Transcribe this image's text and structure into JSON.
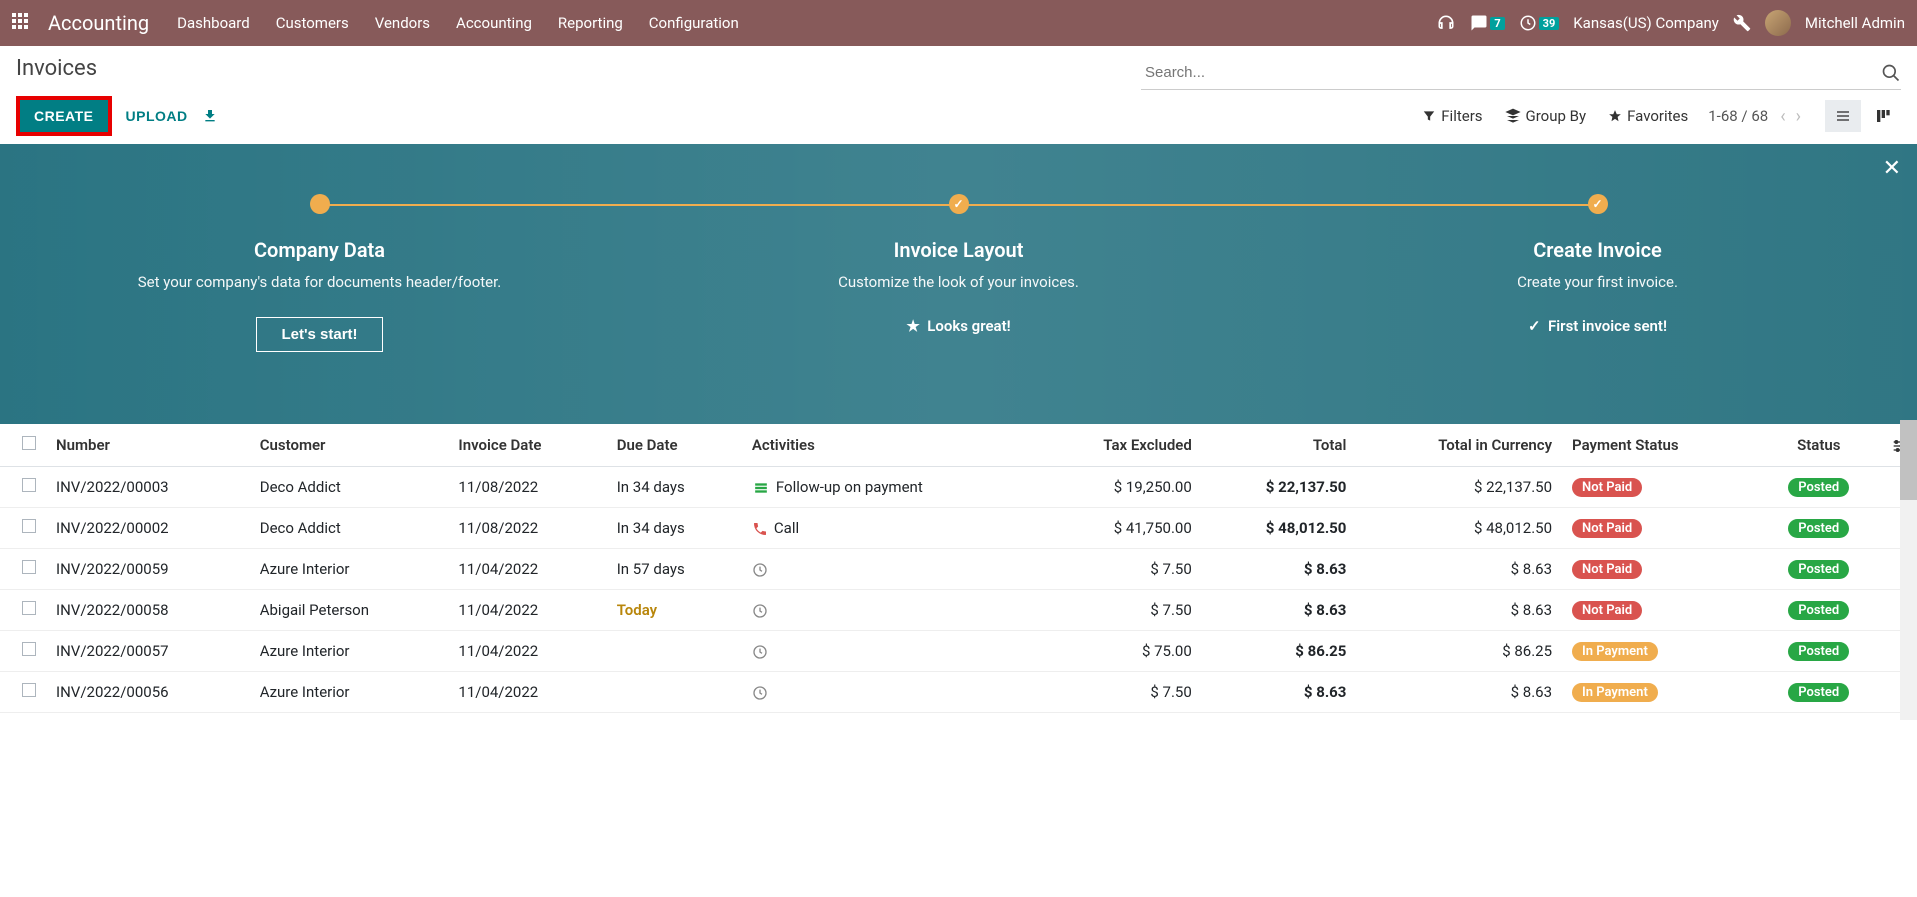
{
  "nav": {
    "brand": "Accounting",
    "menu": [
      "Dashboard",
      "Customers",
      "Vendors",
      "Accounting",
      "Reporting",
      "Configuration"
    ],
    "messages_count": "7",
    "activities_count": "39",
    "company": "Kansas(US) Company",
    "user": "Mitchell Admin"
  },
  "cp": {
    "title": "Invoices",
    "create": "CREATE",
    "upload": "UPLOAD",
    "search_placeholder": "Search...",
    "filters": "Filters",
    "groupby": "Group By",
    "favorites": "Favorites",
    "pager": "1-68 / 68"
  },
  "onboard": {
    "steps": [
      {
        "title": "Company Data",
        "desc": "Set your company's data for documents header/footer.",
        "action": "Let's start!",
        "done": false,
        "action_type": "button"
      },
      {
        "title": "Invoice Layout",
        "desc": "Customize the look of your invoices.",
        "action": "Looks great!",
        "done": true,
        "action_type": "text",
        "action_icon": "star"
      },
      {
        "title": "Create Invoice",
        "desc": "Create your first invoice.",
        "action": "First invoice sent!",
        "done": true,
        "action_type": "text",
        "action_icon": "check"
      }
    ]
  },
  "table": {
    "headers": {
      "number": "Number",
      "customer": "Customer",
      "invoice_date": "Invoice Date",
      "due_date": "Due Date",
      "activities": "Activities",
      "tax_excluded": "Tax Excluded",
      "total": "Total",
      "total_currency": "Total in Currency",
      "payment_status": "Payment Status",
      "status": "Status"
    },
    "rows": [
      {
        "number": "INV/2022/00003",
        "customer": "Deco Addict",
        "invoice_date": "11/08/2022",
        "due_date": "In 34 days",
        "due_class": "",
        "activity_icon": "followup",
        "activity": "Follow-up on payment",
        "tax_excluded": "$ 19,250.00",
        "total": "$ 22,137.50",
        "total_currency": "$ 22,137.50",
        "payment_status": "Not Paid",
        "payment_class": "pill-red",
        "status": "Posted"
      },
      {
        "number": "INV/2022/00002",
        "customer": "Deco Addict",
        "invoice_date": "11/08/2022",
        "due_date": "In 34 days",
        "due_class": "",
        "activity_icon": "call",
        "activity": "Call",
        "tax_excluded": "$ 41,750.00",
        "total": "$ 48,012.50",
        "total_currency": "$ 48,012.50",
        "payment_status": "Not Paid",
        "payment_class": "pill-red",
        "status": "Posted"
      },
      {
        "number": "INV/2022/00059",
        "customer": "Azure Interior",
        "invoice_date": "11/04/2022",
        "due_date": "In 57 days",
        "due_class": "",
        "activity_icon": "clock",
        "activity": "",
        "tax_excluded": "$ 7.50",
        "total": "$ 8.63",
        "total_currency": "$ 8.63",
        "payment_status": "Not Paid",
        "payment_class": "pill-red",
        "status": "Posted"
      },
      {
        "number": "INV/2022/00058",
        "customer": "Abigail Peterson",
        "invoice_date": "11/04/2022",
        "due_date": "Today",
        "due_class": "due-today",
        "activity_icon": "clock",
        "activity": "",
        "tax_excluded": "$ 7.50",
        "total": "$ 8.63",
        "total_currency": "$ 8.63",
        "payment_status": "Not Paid",
        "payment_class": "pill-red",
        "status": "Posted"
      },
      {
        "number": "INV/2022/00057",
        "customer": "Azure Interior",
        "invoice_date": "11/04/2022",
        "due_date": "",
        "due_class": "",
        "activity_icon": "clock",
        "activity": "",
        "tax_excluded": "$ 75.00",
        "total": "$ 86.25",
        "total_currency": "$ 86.25",
        "payment_status": "In Payment",
        "payment_class": "pill-yellow",
        "status": "Posted"
      },
      {
        "number": "INV/2022/00056",
        "customer": "Azure Interior",
        "invoice_date": "11/04/2022",
        "due_date": "",
        "due_class": "",
        "activity_icon": "clock",
        "activity": "",
        "tax_excluded": "$ 7.50",
        "total": "$ 8.63",
        "total_currency": "$ 8.63",
        "payment_status": "In Payment",
        "payment_class": "pill-yellow",
        "status": "Posted"
      }
    ]
  }
}
